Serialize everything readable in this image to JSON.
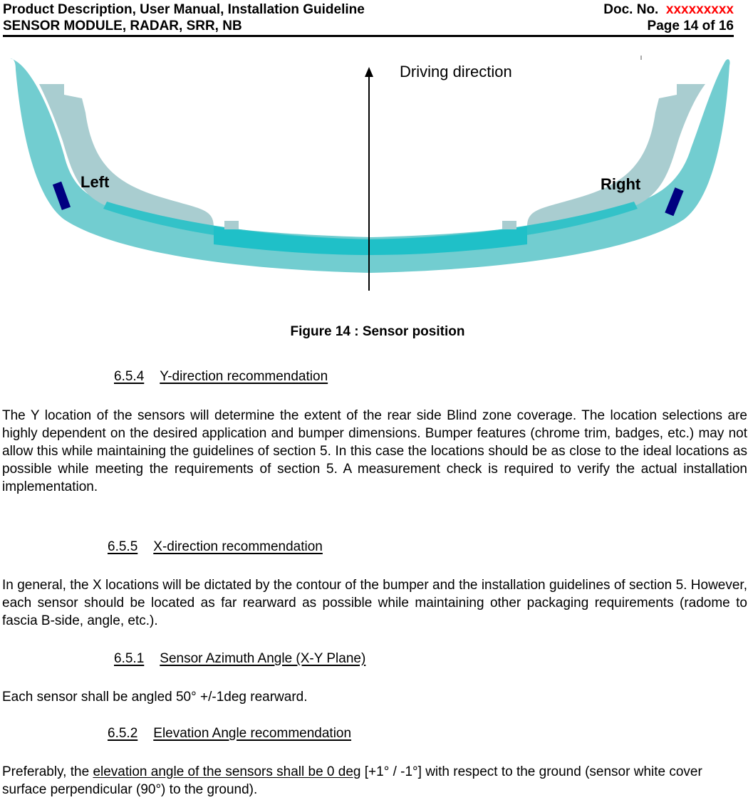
{
  "header": {
    "title_line1": "Product Description, User Manual, Installation Guideline",
    "title_line2": "SENSOR MODULE, RADAR, SRR, NB",
    "doc_no_label": "Doc. No.",
    "doc_no_value": "xxxxxxxxx",
    "page_label": "Page 14 of 16",
    "accent_color": "#ff0000"
  },
  "figure": {
    "driving_direction_label": "Driving direction",
    "left_label": "Left",
    "right_label": "Right",
    "caption": "Figure 14 : Sensor position",
    "sensor_color": "#000080",
    "bumper_color": "#5ec8c8"
  },
  "sections": [
    {
      "number": "6.5.4",
      "title": "Y-direction recommendation",
      "body": "The Y location of the sensors will determine the extent of the rear side Blind zone coverage. The location selections are highly dependent on the desired application and bumper dimensions. Bumper features (chrome trim, badges, etc.) may not allow this while maintaining the guidelines of section 5. In this case the locations should be as close to the ideal locations as possible while meeting the requirements of section 5. A measurement check is required to verify the actual installation implementation."
    },
    {
      "number": "6.5.5",
      "title": "X-direction recommendation",
      "body": "In general, the X locations will be dictated by the contour of the bumper and the installation guidelines of section 5. However, each sensor should be located as far rearward as possible while maintaining other packaging requirements (radome to fascia B-side, angle, etc.)."
    },
    {
      "number": "6.5.1",
      "title": "Sensor Azimuth Angle (X-Y Plane)",
      "body": "Each sensor shall be angled 50° +/-1deg rearward."
    },
    {
      "number": "6.5.2",
      "title": "Elevation Angle recommendation",
      "body_prefix": "Preferably, the ",
      "body_underlined": "elevation angle of the sensors shall be 0 deg",
      "body_suffix": " [+1° / -1°] with respect to the ground (sensor white cover surface perpendicular (90°) to the ground)."
    }
  ]
}
